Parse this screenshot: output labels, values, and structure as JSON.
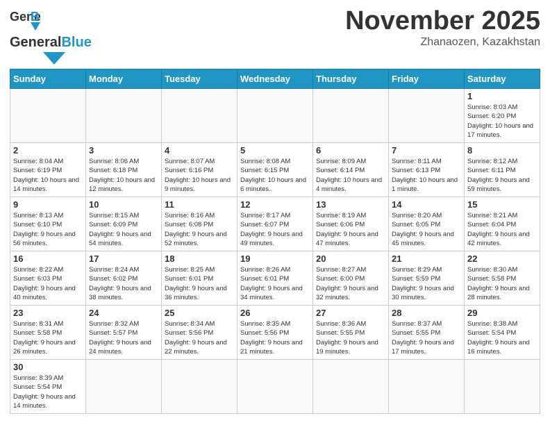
{
  "header": {
    "logo": {
      "general": "General",
      "blue": "Blue"
    },
    "title": "November 2025",
    "location": "Zhanaozen, Kazakhstan"
  },
  "weekdays": [
    "Sunday",
    "Monday",
    "Tuesday",
    "Wednesday",
    "Thursday",
    "Friday",
    "Saturday"
  ],
  "weeks": [
    [
      {
        "day": "",
        "info": ""
      },
      {
        "day": "",
        "info": ""
      },
      {
        "day": "",
        "info": ""
      },
      {
        "day": "",
        "info": ""
      },
      {
        "day": "",
        "info": ""
      },
      {
        "day": "",
        "info": ""
      },
      {
        "day": "1",
        "info": "Sunrise: 8:03 AM\nSunset: 6:20 PM\nDaylight: 10 hours\nand 17 minutes."
      }
    ],
    [
      {
        "day": "2",
        "info": "Sunrise: 8:04 AM\nSunset: 6:19 PM\nDaylight: 10 hours\nand 14 minutes."
      },
      {
        "day": "3",
        "info": "Sunrise: 8:06 AM\nSunset: 6:18 PM\nDaylight: 10 hours\nand 12 minutes."
      },
      {
        "day": "4",
        "info": "Sunrise: 8:07 AM\nSunset: 6:16 PM\nDaylight: 10 hours\nand 9 minutes."
      },
      {
        "day": "5",
        "info": "Sunrise: 8:08 AM\nSunset: 6:15 PM\nDaylight: 10 hours\nand 6 minutes."
      },
      {
        "day": "6",
        "info": "Sunrise: 8:09 AM\nSunset: 6:14 PM\nDaylight: 10 hours\nand 4 minutes."
      },
      {
        "day": "7",
        "info": "Sunrise: 8:11 AM\nSunset: 6:13 PM\nDaylight: 10 hours\nand 1 minute."
      },
      {
        "day": "8",
        "info": "Sunrise: 8:12 AM\nSunset: 6:11 PM\nDaylight: 9 hours\nand 59 minutes."
      }
    ],
    [
      {
        "day": "9",
        "info": "Sunrise: 8:13 AM\nSunset: 6:10 PM\nDaylight: 9 hours\nand 56 minutes."
      },
      {
        "day": "10",
        "info": "Sunrise: 8:15 AM\nSunset: 6:09 PM\nDaylight: 9 hours\nand 54 minutes."
      },
      {
        "day": "11",
        "info": "Sunrise: 8:16 AM\nSunset: 6:08 PM\nDaylight: 9 hours\nand 52 minutes."
      },
      {
        "day": "12",
        "info": "Sunrise: 8:17 AM\nSunset: 6:07 PM\nDaylight: 9 hours\nand 49 minutes."
      },
      {
        "day": "13",
        "info": "Sunrise: 8:19 AM\nSunset: 6:06 PM\nDaylight: 9 hours\nand 47 minutes."
      },
      {
        "day": "14",
        "info": "Sunrise: 8:20 AM\nSunset: 6:05 PM\nDaylight: 9 hours\nand 45 minutes."
      },
      {
        "day": "15",
        "info": "Sunrise: 8:21 AM\nSunset: 6:04 PM\nDaylight: 9 hours\nand 42 minutes."
      }
    ],
    [
      {
        "day": "16",
        "info": "Sunrise: 8:22 AM\nSunset: 6:03 PM\nDaylight: 9 hours\nand 40 minutes."
      },
      {
        "day": "17",
        "info": "Sunrise: 8:24 AM\nSunset: 6:02 PM\nDaylight: 9 hours\nand 38 minutes."
      },
      {
        "day": "18",
        "info": "Sunrise: 8:25 AM\nSunset: 6:01 PM\nDaylight: 9 hours\nand 36 minutes."
      },
      {
        "day": "19",
        "info": "Sunrise: 8:26 AM\nSunset: 6:01 PM\nDaylight: 9 hours\nand 34 minutes."
      },
      {
        "day": "20",
        "info": "Sunrise: 8:27 AM\nSunset: 6:00 PM\nDaylight: 9 hours\nand 32 minutes."
      },
      {
        "day": "21",
        "info": "Sunrise: 8:29 AM\nSunset: 5:59 PM\nDaylight: 9 hours\nand 30 minutes."
      },
      {
        "day": "22",
        "info": "Sunrise: 8:30 AM\nSunset: 5:58 PM\nDaylight: 9 hours\nand 28 minutes."
      }
    ],
    [
      {
        "day": "23",
        "info": "Sunrise: 8:31 AM\nSunset: 5:58 PM\nDaylight: 9 hours\nand 26 minutes."
      },
      {
        "day": "24",
        "info": "Sunrise: 8:32 AM\nSunset: 5:57 PM\nDaylight: 9 hours\nand 24 minutes."
      },
      {
        "day": "25",
        "info": "Sunrise: 8:34 AM\nSunset: 5:56 PM\nDaylight: 9 hours\nand 22 minutes."
      },
      {
        "day": "26",
        "info": "Sunrise: 8:35 AM\nSunset: 5:56 PM\nDaylight: 9 hours\nand 21 minutes."
      },
      {
        "day": "27",
        "info": "Sunrise: 8:36 AM\nSunset: 5:55 PM\nDaylight: 9 hours\nand 19 minutes."
      },
      {
        "day": "28",
        "info": "Sunrise: 8:37 AM\nSunset: 5:55 PM\nDaylight: 9 hours\nand 17 minutes."
      },
      {
        "day": "29",
        "info": "Sunrise: 8:38 AM\nSunset: 5:54 PM\nDaylight: 9 hours\nand 16 minutes."
      }
    ],
    [
      {
        "day": "30",
        "info": "Sunrise: 8:39 AM\nSunset: 5:54 PM\nDaylight: 9 hours\nand 14 minutes."
      },
      {
        "day": "",
        "info": ""
      },
      {
        "day": "",
        "info": ""
      },
      {
        "day": "",
        "info": ""
      },
      {
        "day": "",
        "info": ""
      },
      {
        "day": "",
        "info": ""
      },
      {
        "day": "",
        "info": ""
      }
    ]
  ]
}
